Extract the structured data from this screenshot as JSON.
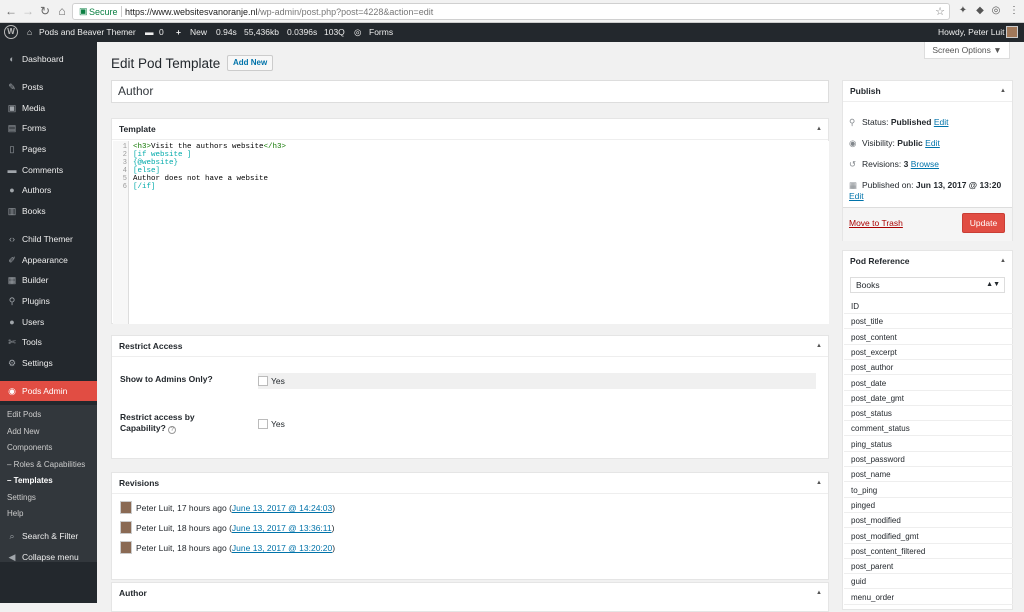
{
  "browser": {
    "secure": "Secure",
    "url_host": "https://www.websitesvanoranje.nl",
    "url_path": "/wp-admin/post.php?post=4228&action=edit"
  },
  "adminbar": {
    "site": "Pods and Beaver Themer",
    "comments": "0",
    "new": "New",
    "stats": [
      "0.94s",
      "55,436kb",
      "0.0396s",
      "103Q"
    ],
    "forms": "Forms",
    "howdy": "Howdy, Peter Luit"
  },
  "menu": [
    {
      "label": "Dashboard",
      "icon": "dashboard-icon",
      "glyph": "◐"
    },
    {
      "label": "Posts",
      "icon": "pin-icon",
      "glyph": "✎"
    },
    {
      "label": "Media",
      "icon": "media-icon",
      "glyph": "▣"
    },
    {
      "label": "Forms",
      "icon": "forms-icon",
      "glyph": "▤"
    },
    {
      "label": "Pages",
      "icon": "pages-icon",
      "glyph": "▯"
    },
    {
      "label": "Comments",
      "icon": "comments-icon",
      "glyph": "▬"
    },
    {
      "label": "Authors",
      "icon": "authors-icon",
      "glyph": "●"
    },
    {
      "label": "Books",
      "icon": "books-icon",
      "glyph": "▥"
    },
    {
      "label": "Child Themer",
      "icon": "code-icon",
      "glyph": "‹›"
    },
    {
      "label": "Appearance",
      "icon": "brush-icon",
      "glyph": "✐"
    },
    {
      "label": "Builder",
      "icon": "builder-icon",
      "glyph": "▦"
    },
    {
      "label": "Plugins",
      "icon": "plugins-icon",
      "glyph": "⚲"
    },
    {
      "label": "Users",
      "icon": "users-icon",
      "glyph": "●"
    },
    {
      "label": "Tools",
      "icon": "tools-icon",
      "glyph": "✄"
    },
    {
      "label": "Settings",
      "icon": "settings-icon",
      "glyph": "⚙"
    },
    {
      "label": "Pods Admin",
      "icon": "pods-icon",
      "glyph": "◉"
    }
  ],
  "submenu": [
    "Edit Pods",
    "Add New",
    "Components",
    "– Roles & Capabilities",
    "– Templates",
    "Settings",
    "Help"
  ],
  "menu_bottom": [
    {
      "label": "Search & Filter",
      "icon": "search-icon",
      "glyph": "⌕"
    },
    {
      "label": "Collapse menu",
      "icon": "collapse-icon",
      "glyph": "◀"
    }
  ],
  "page": {
    "title": "Edit Pod Template",
    "add_new": "Add New",
    "screen_options": "Screen Options ▼",
    "post_title": "Author"
  },
  "template": {
    "title": "Template",
    "lines": [
      "1",
      "2",
      "3",
      "4",
      "5",
      "6"
    ]
  },
  "restrict": {
    "title": "Restrict Access",
    "admins_label": "Show to Admins Only?",
    "cap_label1": "Restrict access by",
    "cap_label2": "Capability?",
    "yes": "Yes",
    "help": "?"
  },
  "revisions": {
    "title": "Revisions",
    "items": [
      {
        "who": "Peter Luit, 17 hours ago (",
        "date": "June 13, 2017 @ 14:24:03",
        "end": ")"
      },
      {
        "who": "Peter Luit, 18 hours ago (",
        "date": "June 13, 2017 @ 13:36:11",
        "end": ")"
      },
      {
        "who": "Peter Luit, 18 hours ago (",
        "date": "June 13, 2017 @ 13:20:20",
        "end": ")"
      }
    ]
  },
  "author_box": {
    "title": "Author"
  },
  "publish": {
    "title": "Publish",
    "status_label": "Status: ",
    "status": "Published",
    "visibility_label": "Visibility: ",
    "visibility": "Public",
    "revisions_label": "Revisions: ",
    "revisions": "3",
    "browse": "Browse",
    "published_label": "Published on: ",
    "published": "Jun 13, 2017 @ 13:20",
    "edit": "Edit",
    "trash": "Move to Trash",
    "update": "Update"
  },
  "podref": {
    "title": "Pod Reference",
    "selected": "Books",
    "fields": [
      "ID",
      "post_title",
      "post_content",
      "post_excerpt",
      "post_author",
      "post_date",
      "post_date_gmt",
      "post_status",
      "comment_status",
      "ping_status",
      "post_password",
      "post_name",
      "to_ping",
      "pinged",
      "post_modified",
      "post_modified_gmt",
      "post_content_filtered",
      "post_parent",
      "guid",
      "menu_order"
    ]
  }
}
